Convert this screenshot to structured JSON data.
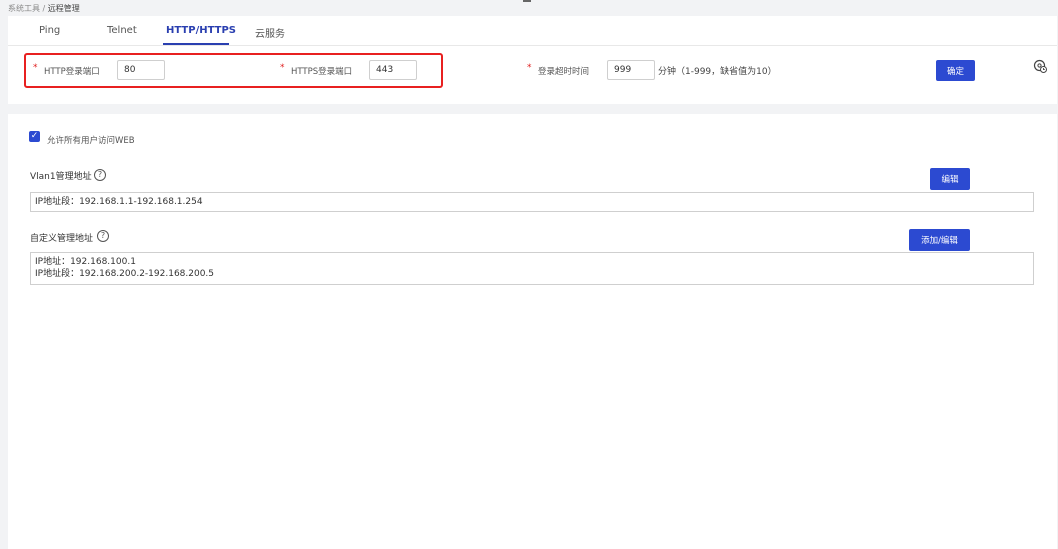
{
  "breadcrumb": {
    "parent": "系统工具 /",
    "current": "远程管理"
  },
  "tabs": [
    {
      "label": "Ping"
    },
    {
      "label": "Telnet"
    },
    {
      "label": "HTTP/HTTPS"
    },
    {
      "label": "云服务"
    }
  ],
  "form": {
    "required_mark": "*",
    "http_port_label": "HTTP登录端口",
    "http_port_value": "80",
    "https_port_label": "HTTPS登录端口",
    "https_port_value": "443",
    "timeout_label": "登录超时时间",
    "timeout_value": "999",
    "timeout_hint": "分钟（1-999，缺省值为10）",
    "confirm_label": "确定"
  },
  "settings": {
    "allow_all_label": "允许所有用户访问WEB",
    "allow_all_checked": true,
    "vlan_title": "Vlan1管理地址",
    "vlan_edit_label": "编辑",
    "vlan_content": "IP地址段：192.168.1.1-192.168.1.254",
    "custom_title": "自定义管理地址",
    "custom_edit_label": "添加/编辑",
    "custom_line1": "IP地址：192.168.100.1",
    "custom_line2": "IP地址段：192.168.200.2-192.168.200.5"
  },
  "icons": {
    "help": "question-circle-icon",
    "settings": "gear-clock-icon",
    "checkbox": "check-icon"
  },
  "colors": {
    "accent": "#2c4ad1",
    "active_tab": "#2a3fb0",
    "highlight": "#e82020",
    "required": "#e02020"
  }
}
